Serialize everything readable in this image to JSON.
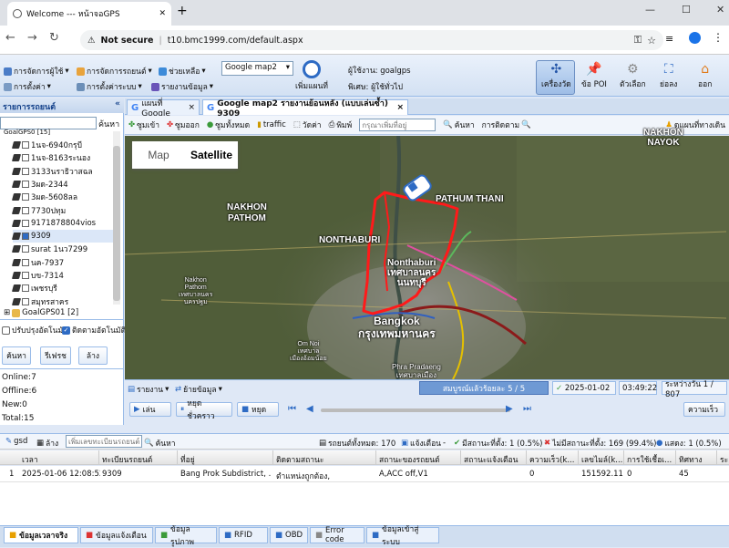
{
  "browser": {
    "tab_title": "Welcome --- หน้าจอGPS",
    "not_secure": "Not secure",
    "url": "t10.bmc1999.com/default.aspx"
  },
  "toolbar": {
    "menu1": "การจัดการผู้ใช้",
    "menu2": "การจัดการรถยนต์",
    "menu3": "การตั้งค่า",
    "menu4": "การตั้งค่าระบบ",
    "help": "ช่วยเหลือ",
    "reports": "รายงานข้อมูล",
    "map_select": "Google map2",
    "full_map": "เพิ่มแผนที่",
    "user_label": "ผู้ใช้งาน: goalgps",
    "special_label": "พิเศษ: ผู้ใช้ทั่วไป",
    "btn_machine": "เครื่องวัด",
    "btn_poi": "ข้อ POI",
    "btn_options": "ตัวเลือก",
    "btn_fullscreen": "ย่อลง",
    "btn_exit": "ออก"
  },
  "left": {
    "header": "รายการรถยนต์",
    "search_btn": "ค้นหา",
    "vehicles": [
      "1นจ-6940กรุบี",
      "1นจ-8163ระนอง",
      "3133นราธิวาสฉล",
      "3ผด-2344",
      "3ผด-5608ลล",
      "7730ปทุม",
      "9171878804vios",
      "9309",
      "surat 1นว7299",
      "นค-7937",
      "บข-7314",
      "เพชรบุรี",
      "สมุทรสาคร"
    ],
    "group": "GoalGPS01 [2]",
    "group_top": "GoalGPS0 [15]",
    "auto_refresh": "ปรับปรุงอัตโนมัติ",
    "auto_follow": "ติดตามอัตโนมัติ",
    "btn_search": "ค้นหา",
    "btn_refresh": "รีเฟรช",
    "btn_clear": "ล้าง",
    "online": "Online:7",
    "offline": "Offline:6",
    "new": "New:0",
    "total": "Total:15"
  },
  "tabs": {
    "google_map": "แผนที่ Google",
    "google_map2": "Google map2 รายงานย้อนหลัง (แบบเล่นซ้ำ) 9309"
  },
  "maptb": {
    "zoom_in": "ซูมเข้า",
    "zoom_out": "ซูมออก",
    "zoom_all": "ซูมทั้งหมด",
    "traffic": "traffic",
    "measure": "วัดค่า",
    "print": "พิมพ์",
    "place_ph": "กรุณาเพิ่มที่อยู่",
    "search": "ค้นหา",
    "tracking": "การติดตาม",
    "street": "ดูแผนที่ทางเดิน"
  },
  "map": {
    "map_btn": "Map",
    "satellite_btn": "Satellite",
    "labels": {
      "nayok": "NAKHON\nNAYOK",
      "pathum_thani": "PATHUM THANI",
      "nakhon_pathom": "NAKHON\nPATHOM",
      "nonthaburi": "NONTHABURI",
      "nonthaburi_city": "Nonthaburi\nเทศบาลนคร\nนนทบุรี",
      "bangkok": "Bangkok\nกรุงเทพมหานคร",
      "phra_pradaeng": "Phra Pradaeng\nเทศบาลเมือง",
      "nakhon_pathom_city": "Nakhon\nPathom\nเทศบาลนคร\nนครปฐม",
      "om_noi": "Om Noi\nเทศบาล\nเมืองอ้อมน้อย"
    }
  },
  "playback": {
    "report": "รายงาน",
    "move": "ย้ายข้อมูล",
    "progress": "สมบูรณ์แล้วร้อยละ 5 / 5",
    "date": "2025-01-02",
    "time": "03:49:22",
    "interval": "ระหว่างวัน 1 / 807",
    "play": "เล่น",
    "pause": "หยุดชั่วคราว",
    "stop": "หยุด",
    "speed": "ความเร็ว"
  },
  "grid": {
    "btn_gsd": "gsd",
    "btn_clear": "ล้าง",
    "search_ph": "เพิ่มเลขทะเบียนรถยนต์",
    "search": "ค้นหา",
    "total": "รถยนต์ทั้งหมด: 170",
    "alert": "แจ้งเตือน",
    "status_ok": "มีสถานะที่ตั้ง: 1 (0.5%)",
    "status_none": "ไม่มีสถานะที่ตั้ง: 169 (99.4%)",
    "show": "แสดง: 1 (0.5%)",
    "headers": [
      "เวลา",
      "ทะเบียนรถยนต์",
      "ที่อยู่",
      "ติดตามสถานะ",
      "สถานะของรถยนต์",
      "สถานะแจ้งเตือน",
      "ความเร็ว(k...",
      "เลขไมล์(k...",
      "การใช้เชื้อเ...",
      "ทิศทาง",
      "ระ"
    ],
    "row": {
      "n": "1",
      "time": "2025-01-06 12:08:52",
      "plate": "9309",
      "addr": "Bang Prok Subdistrict, ...",
      "track": "ตำแหน่งถูกต้อง,",
      "vstatus": "A,ACC off,V1",
      "alert": "",
      "speed": "0",
      "mileage": "151592.11",
      "fuel": "0",
      "dir": "45"
    }
  },
  "bottomtabs": [
    "ข้อมูลเวลาจริง",
    "ข้อมูลแจ้งเตือน",
    "ข้อมูลรูปภาพ",
    "RFID",
    "OBD",
    "Error code",
    "ข้อมูลเข้าสู่ระบบ"
  ],
  "colors": {
    "accent": "#15428b",
    "route_red": "#ff1a1a",
    "panel_bg": "#dfe8f6"
  }
}
